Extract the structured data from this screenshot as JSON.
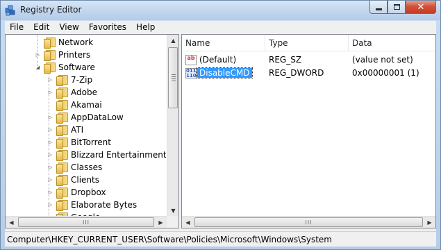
{
  "window": {
    "title": "Registry Editor"
  },
  "caption": {
    "minimize": "▭",
    "maximize": "□",
    "close": "✕"
  },
  "menu": [
    "File",
    "Edit",
    "View",
    "Favorites",
    "Help"
  ],
  "tree": {
    "items": [
      {
        "label": "Network",
        "level": 1,
        "state": "none"
      },
      {
        "label": "Printers",
        "level": 1,
        "state": "collapsed"
      },
      {
        "label": "Software",
        "level": 1,
        "state": "expanded"
      },
      {
        "label": "7-Zip",
        "level": 2,
        "state": "collapsed"
      },
      {
        "label": "Adobe",
        "level": 2,
        "state": "collapsed"
      },
      {
        "label": "Akamai",
        "level": 2,
        "state": "none"
      },
      {
        "label": "AppDataLow",
        "level": 2,
        "state": "collapsed"
      },
      {
        "label": "ATI",
        "level": 2,
        "state": "collapsed"
      },
      {
        "label": "BitTorrent",
        "level": 2,
        "state": "collapsed"
      },
      {
        "label": "Blizzard Entertainment",
        "level": 2,
        "state": "collapsed"
      },
      {
        "label": "Classes",
        "level": 2,
        "state": "collapsed"
      },
      {
        "label": "Clients",
        "level": 2,
        "state": "collapsed"
      },
      {
        "label": "Dropbox",
        "level": 2,
        "state": "collapsed"
      },
      {
        "label": "Elaborate Bytes",
        "level": 2,
        "state": "collapsed"
      },
      {
        "label": "Google",
        "level": 2,
        "state": "collapsed"
      }
    ]
  },
  "list": {
    "columns": [
      "Name",
      "Type",
      "Data"
    ],
    "rows": [
      {
        "name": "(Default)",
        "type": "REG_SZ",
        "data": "(value not set)",
        "icon": "string-value-icon",
        "icon_text": "ab",
        "selected": false
      },
      {
        "name": "DisableCMD",
        "type": "REG_DWORD",
        "data": "0x00000001 (1)",
        "icon": "dword-value-icon",
        "icon_text": "011\n110",
        "selected": true
      }
    ]
  },
  "scroll": {
    "up": "▲",
    "down": "▼",
    "left": "◀",
    "right": "▶",
    "grip": "III"
  },
  "status": {
    "path": "Computer\\HKEY_CURRENT_USER\\Software\\Policies\\Microsoft\\Windows\\System"
  }
}
